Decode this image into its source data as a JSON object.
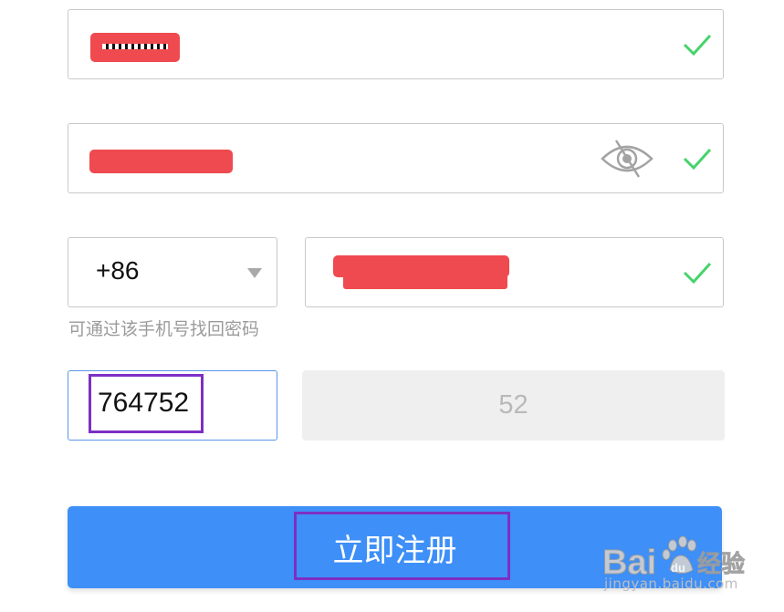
{
  "form": {
    "username": {
      "valid": true
    },
    "password": {
      "valid": true,
      "visibility_icon": "eye-slash-icon"
    },
    "country_code": {
      "value": "+86",
      "dropdown_icon": "triangle-down-icon"
    },
    "phone": {
      "valid": true,
      "hint": "可通过该手机号找回密码"
    },
    "verification_code": {
      "value": "764752"
    },
    "sms_button": {
      "countdown": "52"
    },
    "register_button": {
      "label": "立即注册"
    }
  },
  "colors": {
    "accent": "#3e8ff7",
    "valid": "#46d36b",
    "redaction": "#ef4a4f",
    "highlight": "#7d2fc4"
  },
  "watermark": {
    "brand": "Bai",
    "brand_suffix": "du",
    "product": "经验",
    "domain": "jingyan.baidu.com"
  }
}
